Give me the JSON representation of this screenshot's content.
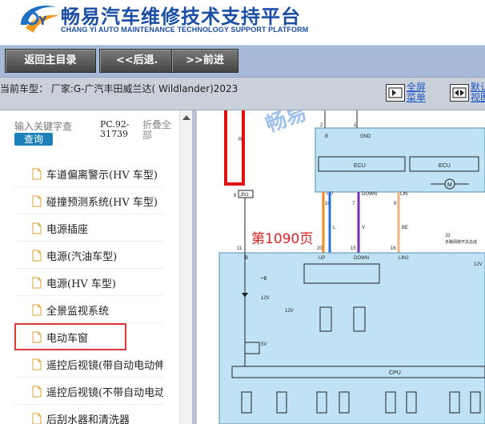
{
  "header": {
    "title_zh": "畅易汽车维修技术支持平台",
    "title_en": "CHANG YI AUTO MAINTENANCE TECHNOLOGY SUPPORT PLATFORM",
    "logo_icon": "cy-logo-icon"
  },
  "nav": {
    "home": "返回主目录",
    "back": "<<后退.",
    "forward": ">>前进"
  },
  "car": {
    "info": "当前车型：  厂家:G-广汽丰田威兰达( Wildlander)2023",
    "fullscreen": "全屏菜单",
    "default_view": "默认视图"
  },
  "sidebar": {
    "search_placeholder": "输入关键字查",
    "query_label": "查询",
    "pc_code": "PC.92-31739",
    "collapse_label": "折叠全部",
    "items": [
      {
        "label": "车道偏离警示(HV 车型)"
      },
      {
        "label": "碰撞预测系统(HV 车型)"
      },
      {
        "label": "电源插座"
      },
      {
        "label": "电源(汽油车型)"
      },
      {
        "label": "电源(HV 车型)"
      },
      {
        "label": "全景监视系统"
      },
      {
        "label": "电动车窗"
      },
      {
        "label": "遥控后视镜(带自动电动伸缩)"
      },
      {
        "label": "遥控后视镜(不带自动电动伸缩)"
      },
      {
        "label": "后刮水器和清洗器"
      }
    ],
    "selected_index": 6
  },
  "diagram": {
    "page_label": "第1090页",
    "watermark": "畅易",
    "labels": {
      "ecu": "ECU",
      "cpu": "CPU",
      "up": "UP",
      "down": "DOWN",
      "lin": "LIN",
      "lin2": "LIN2",
      "b": "B",
      "gnd": "GND",
      "l": "L",
      "v": "V",
      "be": "BE",
      "r": "R",
      "jn1": "JN1",
      "j2": "J2",
      "m": "M",
      "plus_b": "+B",
      "v12": "12V",
      "v5": "5V",
      "pin_2": "2",
      "pin_1": "1",
      "pin_10": "10",
      "pin_7": "7",
      "pin_9": "9",
      "pin_8": "8",
      "pin_11": "11",
      "pin_20": "20",
      "pin_15": "15",
      "pin_16": "16",
      "j2_note": "多路网络开关总成"
    },
    "wire_colors": {
      "red": "#e01010",
      "blue": "#2a6fd6",
      "orange": "#f08a24",
      "purple": "#7a2fb0",
      "peach": "#f2b27a",
      "panel": "#bfe3f4"
    }
  }
}
